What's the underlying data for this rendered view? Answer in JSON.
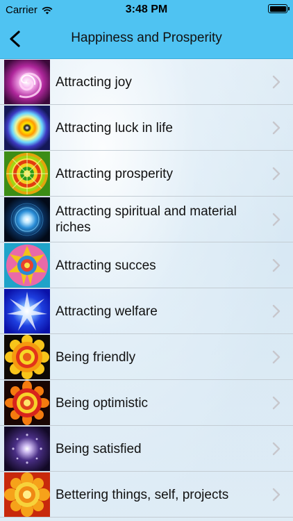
{
  "status_bar": {
    "carrier": "Carrier",
    "time": "3:48 PM"
  },
  "nav": {
    "title": "Happiness and Prosperity",
    "back_icon": "chevron-left-icon"
  },
  "colors": {
    "bar": "#4fc3f2",
    "chevron": "#c7c7cc"
  },
  "items": [
    {
      "label": "Attracting joy",
      "thumbnail": "pink-swirl"
    },
    {
      "label": "Attracting luck in life",
      "thumbnail": "rainbow-halo"
    },
    {
      "label": "Attracting prosperity",
      "thumbnail": "green-mandala"
    },
    {
      "label": "Attracting spiritual and material riches",
      "thumbnail": "blue-light-burst"
    },
    {
      "label": "Attracting succes",
      "thumbnail": "colorful-mandala"
    },
    {
      "label": "Attracting welfare",
      "thumbnail": "blue-star"
    },
    {
      "label": "Being friendly",
      "thumbnail": "yellow-mandala"
    },
    {
      "label": "Being optimistic",
      "thumbnail": "red-orange-mandala"
    },
    {
      "label": "Being satisfied",
      "thumbnail": "purple-sparkle"
    },
    {
      "label": "Bettering things, self, projects",
      "thumbnail": "orange-flower-mandala"
    }
  ]
}
